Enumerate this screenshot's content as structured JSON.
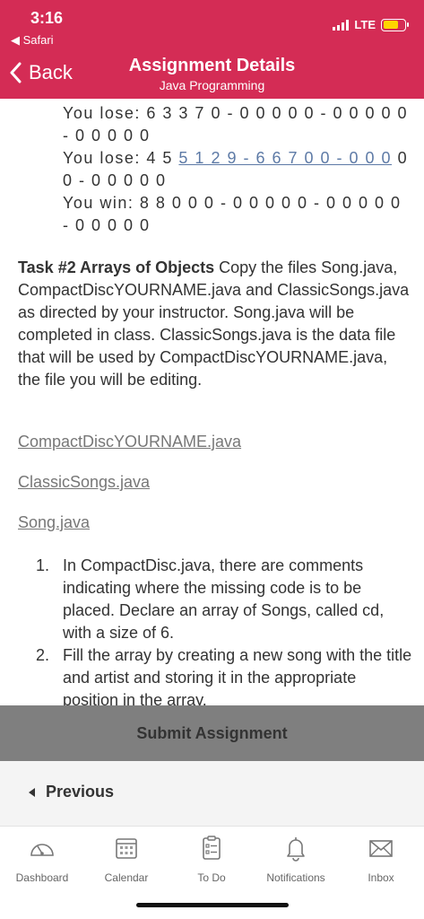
{
  "status": {
    "time": "3:16",
    "back_app": "◀ Safari",
    "network": "LTE",
    "battery_level": 0.7
  },
  "nav": {
    "back_label": "Back",
    "title": "Assignment Details",
    "subtitle": "Java Programming"
  },
  "lines": [
    "You lose:  6 3 3 7 0 - 0 0 0 0 0 - 0 0 0 0 0",
    "- 0 0 0 0 0",
    "You lose:  4 5 ",
    "5 1 2 9 - 6 6 7 0 0 - 0 0 0",
    " 0",
    "0 - 0 0 0 0 0",
    "You win:   8 8 0 0 0 - 0 0 0 0 0 - 0 0 0 0 0",
    "- 0 0 0 0 0"
  ],
  "task": {
    "heading": "Task #2 Arrays of Objects",
    "body": " Copy the files Song.java, CompactDiscYOURNAME.java and ClassicSongs.java as directed by your instructor. Song.java will be completed in class. ClassicSongs.java is the data file that will be used by CompactDiscYOURNAME.java, the file you will be editing."
  },
  "files": [
    "CompactDiscYOURNAME.java",
    "ClassicSongs.java",
    "Song.java"
  ],
  "steps": [
    {
      "num": "1.",
      "text": "In CompactDisc.java, there are comments indicating where the missing code is to be placed. Declare an array of Songs, called cd, with a size of 6."
    },
    {
      "num": "2.",
      "text": "Fill the array by creating a new song with the title and artist and storing it in the appropriate position in the array."
    }
  ],
  "submit_label": "Submit Assignment",
  "previous_label": "Previous",
  "tabs": [
    {
      "label": "Dashboard",
      "icon": "dashboard-icon"
    },
    {
      "label": "Calendar",
      "icon": "calendar-icon"
    },
    {
      "label": "To Do",
      "icon": "todo-icon"
    },
    {
      "label": "Notifications",
      "icon": "bell-icon"
    },
    {
      "label": "Inbox",
      "icon": "inbox-icon"
    }
  ],
  "colors": {
    "header": "#d42c55",
    "submit_bar": "#7f7f7f",
    "link": "#5d7aa6"
  }
}
